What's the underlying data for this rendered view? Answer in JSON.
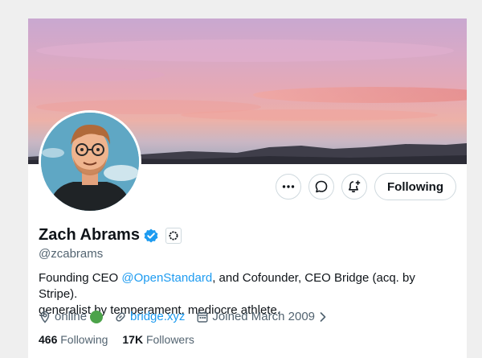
{
  "profile": {
    "name": "Zach Abrams",
    "handle": "@zcabrams",
    "bio_prefix": "Founding CEO ",
    "bio_mention": "@OpenStandard",
    "bio_suffix": ", and Cofounder, CEO Bridge (acq. by Stripe).",
    "bio_line2": "generalist by temperament. mediocre athlete.",
    "location": "online",
    "website": "bridge.xyz",
    "joined": "Joined March 2009",
    "following_count": "466",
    "following_label": "Following",
    "followers_count": "17K",
    "followers_label": "Followers"
  },
  "actions": {
    "more_icon": "more-icon",
    "message_icon": "message-icon",
    "notify_icon": "notify-bell-icon",
    "follow_label": "Following"
  },
  "colors": {
    "accent": "#1d9bf0",
    "verified": "#1d9bf0",
    "online_dot": "#4ca34a",
    "muted_text": "#536471"
  }
}
